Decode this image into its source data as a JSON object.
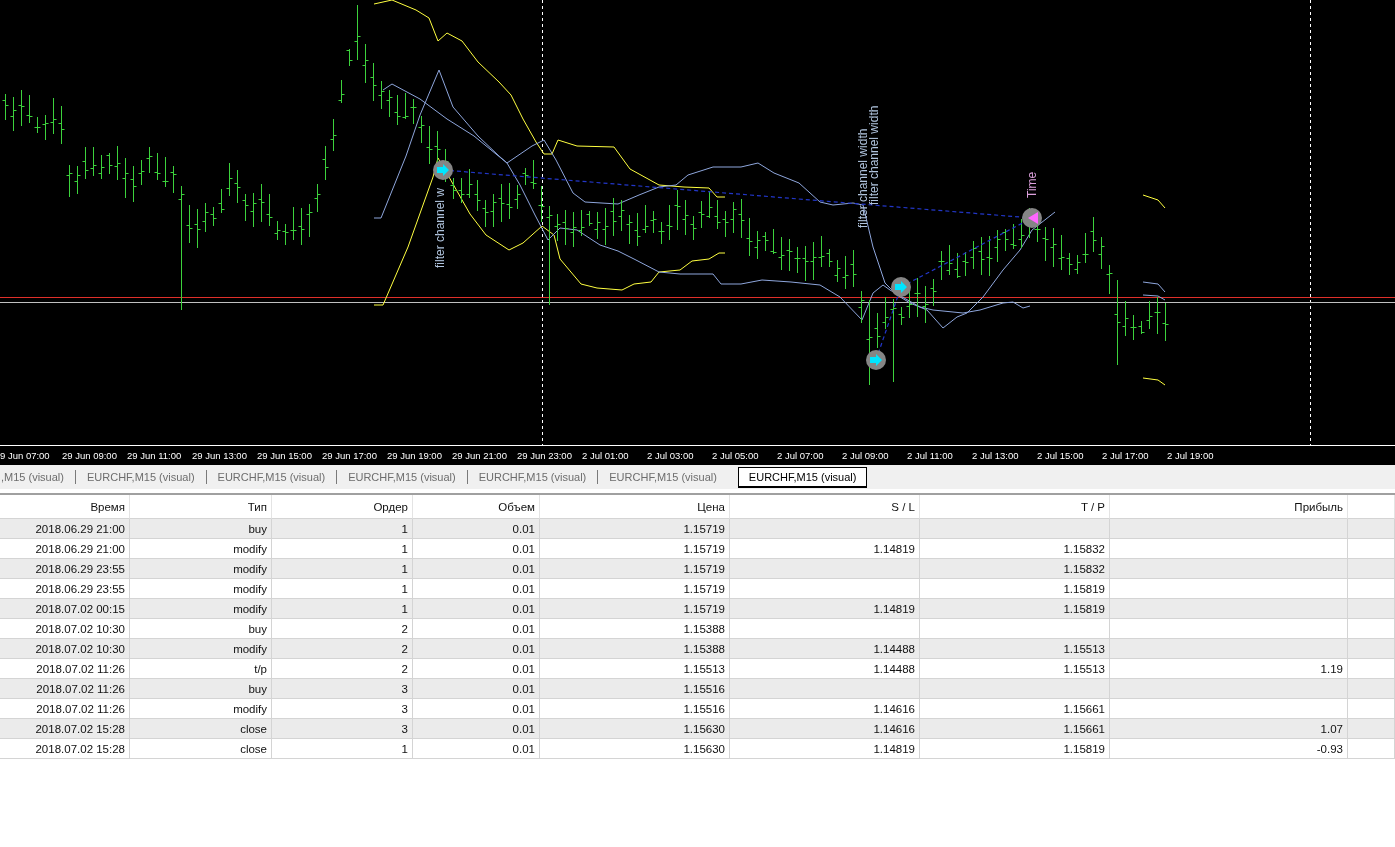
{
  "chart": {
    "annotations": [
      {
        "text": "filter channel w",
        "color": "#b0c4de"
      },
      {
        "text": "filter channel width",
        "color": "#b0c4de"
      },
      {
        "text": "filter channel width",
        "color": "#b0c4de"
      },
      {
        "text": "Time",
        "color": "#dda0dd"
      }
    ],
    "time_labels": [
      "9 Jun 07:00",
      "29 Jun 09:00",
      "29 Jun 11:00",
      "29 Jun 13:00",
      "29 Jun 15:00",
      "29 Jun 17:00",
      "29 Jun 19:00",
      "29 Jun 21:00",
      "29 Jun 23:00",
      "2 Jul 01:00",
      "2 Jul 03:00",
      "2 Jul 05:00",
      "2 Jul 07:00",
      "2 Jul 09:00",
      "2 Jul 11:00",
      "2 Jul 13:00",
      "2 Jul 15:00",
      "2 Jul 17:00",
      "2 Jul 19:00"
    ]
  },
  "tabs": [
    {
      "label": ",M15 (visual)",
      "selected": false
    },
    {
      "label": "EURCHF,M15 (visual)",
      "selected": false
    },
    {
      "label": "EURCHF,M15 (visual)",
      "selected": false
    },
    {
      "label": "EURCHF,M15 (visual)",
      "selected": false
    },
    {
      "label": "EURCHF,M15 (visual)",
      "selected": false
    },
    {
      "label": "EURCHF,M15 (visual)",
      "selected": false
    },
    {
      "label": "EURCHF,M15 (visual)",
      "selected": true
    }
  ],
  "table": {
    "columns": [
      "Время",
      "Тип",
      "Ордер",
      "Объем",
      "Цена",
      "S / L",
      "T / P",
      "Прибыль"
    ],
    "rows": [
      {
        "time": "2018.06.29 21:00",
        "type": "buy",
        "order": "1",
        "volume": "0.01",
        "price": "1.15719"
      },
      {
        "time": "2018.06.29 21:00",
        "type": "modify",
        "order": "1",
        "volume": "0.01",
        "price": "1.15719",
        "sl": "1.14819",
        "tp": "1.15832"
      },
      {
        "time": "2018.06.29 23:55",
        "type": "modify",
        "order": "1",
        "volume": "0.01",
        "price": "1.15719",
        "tp": "1.15832"
      },
      {
        "time": "2018.06.29 23:55",
        "type": "modify",
        "order": "1",
        "volume": "0.01",
        "price": "1.15719",
        "tp": "1.15819"
      },
      {
        "time": "2018.07.02 00:15",
        "type": "modify",
        "order": "1",
        "volume": "0.01",
        "price": "1.15719",
        "sl": "1.14819",
        "tp": "1.15819"
      },
      {
        "time": "2018.07.02 10:30",
        "type": "buy",
        "order": "2",
        "volume": "0.01",
        "price": "1.15388"
      },
      {
        "time": "2018.07.02 10:30",
        "type": "modify",
        "order": "2",
        "volume": "0.01",
        "price": "1.15388",
        "sl": "1.14488",
        "tp": "1.15513"
      },
      {
        "time": "2018.07.02 11:26",
        "type": "t/p",
        "order": "2",
        "volume": "0.01",
        "price": "1.15513",
        "sl": "1.14488",
        "tp": "1.15513",
        "profit": "1.19"
      },
      {
        "time": "2018.07.02 11:26",
        "type": "buy",
        "order": "3",
        "volume": "0.01",
        "price": "1.15516"
      },
      {
        "time": "2018.07.02 11:26",
        "type": "modify",
        "order": "3",
        "volume": "0.01",
        "price": "1.15516",
        "sl": "1.14616",
        "tp": "1.15661"
      },
      {
        "time": "2018.07.02 15:28",
        "type": "close",
        "order": "3",
        "volume": "0.01",
        "price": "1.15630",
        "sl": "1.14616",
        "tp": "1.15661",
        "profit": "1.07"
      },
      {
        "time": "2018.07.02 15:28",
        "type": "close",
        "order": "1",
        "volume": "0.01",
        "price": "1.15630",
        "sl": "1.14819",
        "tp": "1.15819",
        "profit": "-0.93"
      }
    ]
  }
}
